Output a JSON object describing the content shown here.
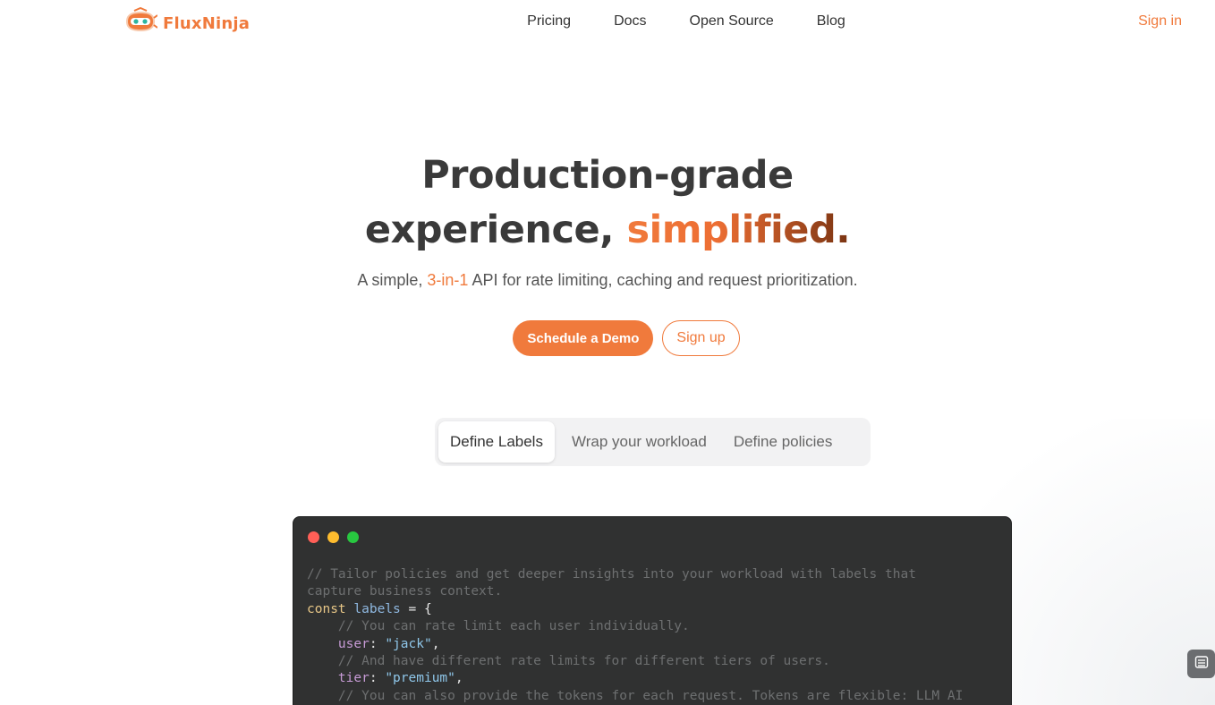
{
  "brand": {
    "name": "FluxNinja",
    "color": "#f07a3c",
    "logo_icon": "ninja-mask-icon"
  },
  "nav": {
    "items": [
      "Pricing",
      "Docs",
      "Open Source",
      "Blog"
    ],
    "signin": "Sign in"
  },
  "hero": {
    "title_line1": "Production-grade",
    "title_line2_plain": "experience,",
    "title_line2_accent": "simplified.",
    "subtitle_prefix": "A simple,",
    "subtitle_highlight": "3-in-1",
    "subtitle_suffix": "API for rate limiting, caching and request prioritization.",
    "cta_primary": "Schedule a Demo",
    "cta_secondary": "Sign up"
  },
  "tabs": [
    {
      "label": "Define Labels",
      "active": true
    },
    {
      "label": "Wrap your workload",
      "active": false
    },
    {
      "label": "Define policies",
      "active": false
    }
  ],
  "code": {
    "comment1": "// Tailor policies and get deeper insights into your workload with labels that",
    "comment2": "capture business context.",
    "kw_const": "const",
    "var_labels": "labels",
    "op_open": " = {",
    "comment3": "    // You can rate limit each user individually.",
    "prop_user": "user",
    "str_jack": "\"jack\"",
    "comment4": "    // And have different rate limits for different tiers of users.",
    "prop_tier": "tier",
    "str_premium": "\"premium\"",
    "comment5": "    // You can also provide the tokens for each request. Tokens are flexible: LLM AI"
  },
  "widget": {
    "icon": "chat-list-icon"
  }
}
